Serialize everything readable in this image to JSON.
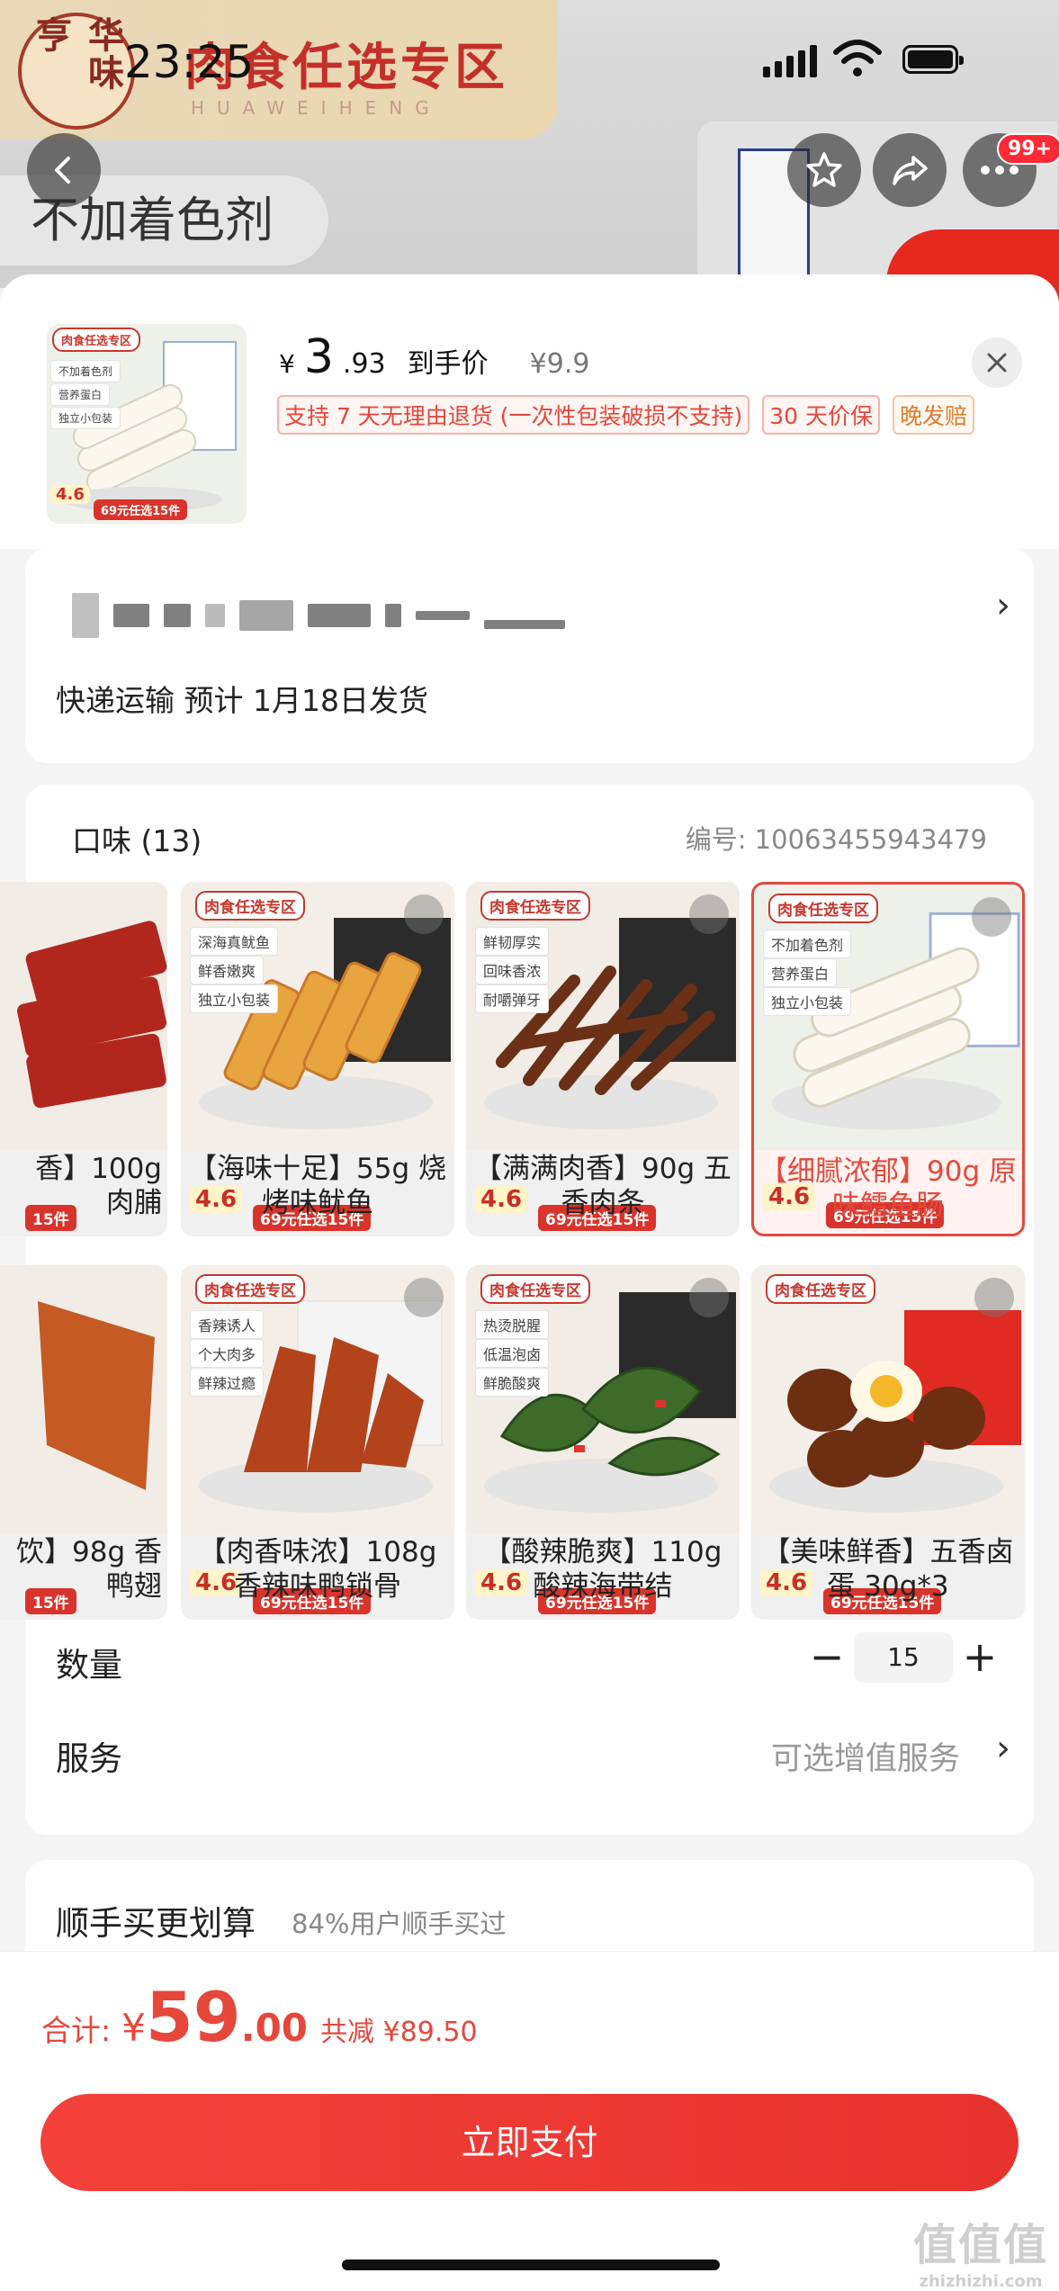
{
  "background": {
    "brand_logo": "华味亨",
    "banner_title": "肉食任选专区",
    "banner_sub": "HUAWEIHENG",
    "chip": "不加着色剂"
  },
  "status_bar": {
    "time": "23:25"
  },
  "nav": {
    "badge": "99+"
  },
  "product": {
    "price_symbol": "¥",
    "price_int": "3",
    "price_dec": ".93",
    "price_label": "到手价",
    "original_price": "¥9.9",
    "tags": [
      "支持 7 天无理由退货 (一次性包装破损不支持)",
      "30 天价保",
      "晚发赔"
    ],
    "thumb": {
      "pill": "肉食任选专区",
      "features": [
        "不加着色剂",
        "营养蛋白",
        "独立小包装"
      ],
      "rating": "4.6",
      "promo": "69元任选15件"
    }
  },
  "shipping": {
    "text": "快递运输 预计 1月18日发货"
  },
  "flavor": {
    "title": "口味 (13)",
    "sku": "编号: 10063455943479",
    "items": [
      {
        "caption": "香】100g\n肉脯",
        "pill": "",
        "features": [],
        "rating": "",
        "promo": "15件"
      },
      {
        "caption": "【海味十足】55g 烧烤味鱿鱼",
        "pill": "肉食任选专区",
        "features": [
          "深海真鱿鱼",
          "鲜香嫩爽",
          "独立小包装"
        ],
        "rating": "4.6",
        "promo": "69元任选15件"
      },
      {
        "caption": "【满满肉香】90g 五香肉条",
        "pill": "肉食任选专区",
        "features": [
          "鲜韧厚实",
          "回味香浓",
          "耐嚼弹牙"
        ],
        "rating": "4.6",
        "promo": "69元任选15件"
      },
      {
        "caption": "【细腻浓郁】90g 原味鳕鱼肠",
        "pill": "肉食任选专区",
        "features": [
          "不加着色剂",
          "营养蛋白",
          "独立小包装"
        ],
        "rating": "4.6",
        "promo": "69元任选15件"
      },
      {
        "caption": "饮】98g 香\n鸭翅",
        "pill": "",
        "features": [],
        "rating": "",
        "promo": "15件"
      },
      {
        "caption": "【肉香味浓】108g 香辣味鸭锁骨",
        "pill": "肉食任选专区",
        "features": [
          "香辣诱人",
          "个大肉多",
          "鲜辣过瘾"
        ],
        "rating": "4.6",
        "promo": "69元任选15件"
      },
      {
        "caption": "【酸辣脆爽】110g 酸辣海带结",
        "pill": "肉食任选专区",
        "features": [
          "热烫脱腥",
          "低温泡卤",
          "鲜脆酸爽"
        ],
        "rating": "4.6",
        "promo": "69元任选15件"
      },
      {
        "caption": "【美味鲜香】五香卤蛋 30g*3",
        "pill": "肉食任选专区",
        "features": [],
        "rating": "4.6",
        "promo": "69元任选15件"
      }
    ]
  },
  "quantity": {
    "label": "数量",
    "value": "15",
    "minus": "−",
    "plus": "+"
  },
  "service": {
    "label": "服务",
    "value": "可选增值服务"
  },
  "more": {
    "title": "顺手买更划算",
    "sub": "84%用户顺手买过"
  },
  "footer": {
    "total_label": "合计:",
    "symbol": "¥",
    "int": "59",
    "dec": ".00",
    "save": "共减 ¥89.50",
    "pay": "立即支付"
  },
  "watermark": {
    "main": "值值值",
    "sub": "zhizhizhi.com"
  },
  "colors": {
    "accent": "#e5473a",
    "pay_button": "#f3413a"
  }
}
